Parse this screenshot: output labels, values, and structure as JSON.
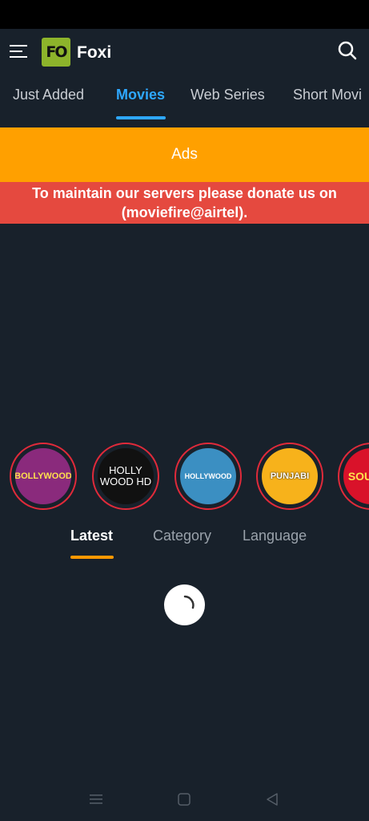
{
  "app": {
    "title": "Foxi",
    "logo_text": "FO"
  },
  "tabs": [
    {
      "label": "Just Added"
    },
    {
      "label": "Movies"
    },
    {
      "label": "Web Series"
    },
    {
      "label": "Short Movi"
    }
  ],
  "active_tab": "Movies",
  "ads": {
    "label": "Ads"
  },
  "donate": {
    "message": "To maintain our servers please donate us on (moviefire@airtel)."
  },
  "categories": [
    {
      "name": "bollywood",
      "text": "BOLLYWOOD"
    },
    {
      "name": "hollywood-hd",
      "text": "HOLLY WOOD HD"
    },
    {
      "name": "hollywood",
      "text": "HOLLYWOOD"
    },
    {
      "name": "punjabi",
      "text": "PUNJABI"
    },
    {
      "name": "south-indian",
      "text": "SOU IND"
    }
  ],
  "subtabs": [
    {
      "label": "Latest"
    },
    {
      "label": "Category"
    },
    {
      "label": "Language"
    }
  ],
  "active_subtab": "Latest",
  "colors": {
    "background": "#18212b",
    "accent_blue": "#2ea8ff",
    "ads_orange": "#ffa000",
    "donate_red": "#e5493f",
    "subtab_orange": "#ff9800",
    "logo_green": "#8db42b"
  },
  "icons": {
    "menu": "menu-icon",
    "search": "search-icon",
    "loading": "loading-spinner-icon",
    "nav_recents": "recents-icon",
    "nav_home": "home-icon",
    "nav_back": "back-icon"
  }
}
